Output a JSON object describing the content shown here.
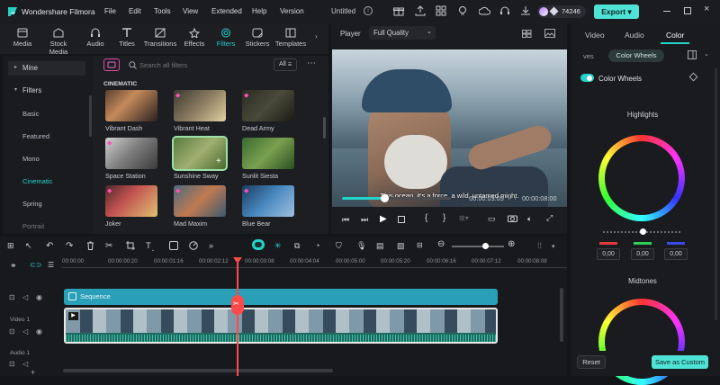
{
  "app": {
    "name": "Wondershare Filmora",
    "menus": [
      "File",
      "Edit",
      "Tools",
      "View",
      "Extended",
      "Help",
      "Version"
    ],
    "project_title": "Untitled",
    "credits": "74246",
    "export_label": "Export"
  },
  "toolbar": {
    "tabs": [
      "Media",
      "Stock Media",
      "Audio",
      "Titles",
      "Transitions",
      "Effects",
      "Filters",
      "Stickers",
      "Templates"
    ],
    "active": "Filters"
  },
  "sidebar": {
    "mine": "Mine",
    "filters": "Filters",
    "items": [
      "Basic",
      "Featured",
      "Mono",
      "Cinematic",
      "Spring",
      "Portrait"
    ],
    "active": "Cinematic"
  },
  "filters_panel": {
    "search_placeholder": "Search all filters",
    "sort_label": "All",
    "section": "CINEMATIC",
    "items": [
      "Vibrant Dash",
      "Vibrant Heat",
      "Dead Army",
      "Space Station",
      "Sunshine Sway",
      "Sunlit Siesta",
      "Joker",
      "Mad Maxim",
      "Blue Bear"
    ]
  },
  "player": {
    "label": "Player",
    "quality": "Full Quality",
    "subtitle": "This ocean, it's a force, a wild, untamed might.",
    "current_time": "00:00:03:05",
    "separator": "/",
    "total_time": "00:00:08:00",
    "progress": 0.39
  },
  "properties": {
    "tabs": [
      "Video",
      "Audio",
      "Color"
    ],
    "active_tab": "Color",
    "subtabs": [
      "ves",
      "Color Wheels"
    ],
    "section_title": "Color Wheels",
    "highlights_label": "Highlights",
    "midtones_label": "Midtones",
    "rgb_values": [
      "0,00",
      "0,00",
      "0,00"
    ],
    "reset_label": "Reset",
    "save_label": "Save as Custom"
  },
  "timeline": {
    "ruler": [
      "00:00:00",
      "00:00:00:20",
      "00:00:01:16",
      "00:00:02:12",
      "00:00:03:08",
      "00:00:04:04",
      "00:00:05:00",
      "00:00:05:20",
      "00:00:06:16",
      "00:00:07:12",
      "00:00:08:08"
    ],
    "sequence_label": "Sequence",
    "video_track": "Video 1",
    "audio_track": "Audio 1"
  },
  "colors": {
    "accent": "#23d3c9",
    "playhead": "#ff4a4a",
    "export_bg": "#4fe3d6"
  }
}
